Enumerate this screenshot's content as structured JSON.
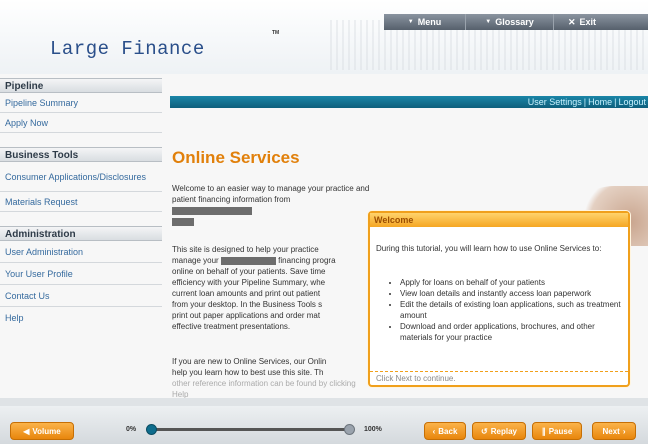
{
  "header": {
    "logo": "Large Finance",
    "tm": "TM",
    "nav": {
      "menu": "Menu",
      "glossary": "Glossary",
      "exit": "Exit"
    }
  },
  "user_links": [
    "User Settings",
    "Home",
    "Logout"
  ],
  "sidebar": {
    "sections": [
      {
        "title": "Pipeline",
        "items": [
          "Pipeline Summary",
          "Apply Now"
        ]
      },
      {
        "title": "Business Tools",
        "items": [
          "Consumer Applications/Disclosures",
          "Materials Request"
        ]
      },
      {
        "title": "Administration",
        "items": [
          "User Administration",
          "Your User Profile",
          "Contact Us",
          "Help"
        ]
      }
    ]
  },
  "main": {
    "title": "Online Services",
    "welcome_a": "Welcome to an easier way to manage your practice and",
    "welcome_b": "patient financing information from",
    "p2_l1": "This site is designed to help your practice",
    "p2_l2a": "manage your",
    "p2_l2b": "financing progra",
    "p2_l3": "online on behalf of your patients. Save time",
    "p2_l4": "efficiency with your Pipeline Summary, whe",
    "p2_l5": "current loan amounts and print out patient",
    "p2_l6": "from your desktop. In the Business Tools s",
    "p2_l7": "print out paper applications and order mat",
    "p2_l8": "effective treatment presentations.",
    "p3_l1": "If you are new to Online Services, our Onlin",
    "p3_l2": "help you learn how to best use this site. Th",
    "p3_l3": "other reference information can be found by clicking Help"
  },
  "popup": {
    "title": "Welcome",
    "intro": "During this tutorial, you will learn how to use Online Services to:",
    "bullets": [
      "Apply for loans on behalf of your patients",
      "View loan details and instantly access loan paperwork",
      "Edit the details of existing loan applications, such as treatment amount",
      "Download and order applications, brochures, and other materials for your practice"
    ],
    "footer": "Click Next to continue."
  },
  "controls": {
    "volume": "Volume",
    "progress_start": "0%",
    "progress_end": "100%",
    "progress_fraction": 0.0,
    "back": "Back",
    "replay": "Replay",
    "pause": "Pause",
    "next": "Next"
  },
  "icons": {
    "volume": "speaker-icon",
    "back": "chevron-left-icon",
    "replay": "replay-icon",
    "pause": "pause-icon",
    "next": "chevron-right-icon"
  },
  "colors": {
    "accent": "#e1800b",
    "link": "#356a9e",
    "band": "#1b86a8"
  }
}
